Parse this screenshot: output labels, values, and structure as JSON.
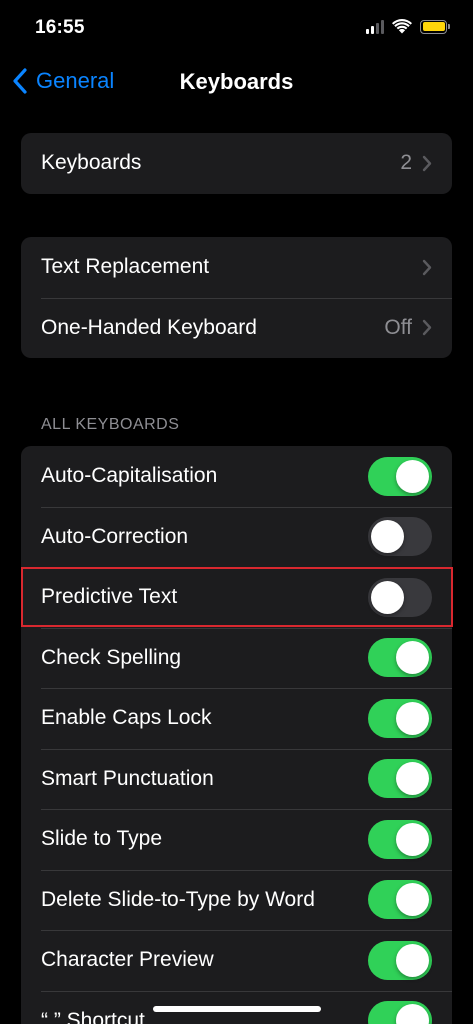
{
  "status_bar": {
    "time": "16:55",
    "battery_color": "#ffd60a"
  },
  "nav": {
    "back_label": "General",
    "title": "Keyboards"
  },
  "group1": [
    {
      "label": "Keyboards",
      "value": "2"
    }
  ],
  "group2": [
    {
      "label": "Text Replacement",
      "value": ""
    },
    {
      "label": "One-Handed Keyboard",
      "value": "Off"
    }
  ],
  "all_keyboards": {
    "header": "ALL KEYBOARDS",
    "items": [
      {
        "label": "Auto-Capitalisation",
        "on": true
      },
      {
        "label": "Auto-Correction",
        "on": false
      },
      {
        "label": "Predictive Text",
        "on": false
      },
      {
        "label": "Check Spelling",
        "on": true
      },
      {
        "label": "Enable Caps Lock",
        "on": true
      },
      {
        "label": "Smart Punctuation",
        "on": true
      },
      {
        "label": "Slide to Type",
        "on": true
      },
      {
        "label": "Delete Slide-to-Type by Word",
        "on": true
      },
      {
        "label": "Character Preview",
        "on": true
      },
      {
        "label": "“.” Shortcut",
        "on": true
      }
    ]
  },
  "colors": {
    "accent": "#0a84ff",
    "toggle_on": "#30d158",
    "toggle_off": "#39393d",
    "highlight": "#d9282f"
  }
}
